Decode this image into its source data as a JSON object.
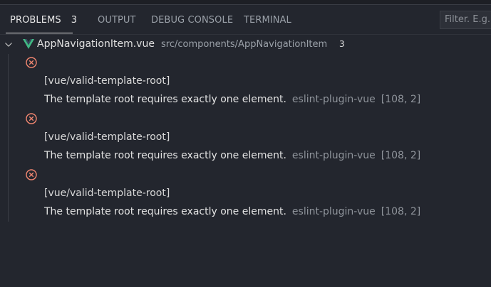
{
  "panel": {
    "tabs": [
      {
        "label": "PROBLEMS",
        "count": "3"
      },
      {
        "label": "OUTPUT"
      },
      {
        "label": "DEBUG CONSOLE"
      },
      {
        "label": "TERMINAL"
      }
    ],
    "filter_placeholder": "Filter. E.g.:"
  },
  "file": {
    "name": "AppNavigationItem.vue",
    "path": "src/components/AppNavigationItem",
    "count": "3",
    "icon": "vue-icon"
  },
  "problems": [
    {
      "severity": "error",
      "rule": "[vue/valid-template-root]",
      "message": "The template root requires exactly one element.",
      "source": "eslint-plugin-vue",
      "location": "[108, 2]"
    },
    {
      "severity": "error",
      "rule": "[vue/valid-template-root]",
      "message": "The template root requires exactly one element.",
      "source": "eslint-plugin-vue",
      "location": "[108, 2]"
    },
    {
      "severity": "error",
      "rule": "[vue/valid-template-root]",
      "message": "The template root requires exactly one element.",
      "source": "eslint-plugin-vue",
      "location": "[108, 2]"
    }
  ],
  "colors": {
    "background": "#23262e",
    "error": "#f48771",
    "vue_green": "#41b883"
  }
}
